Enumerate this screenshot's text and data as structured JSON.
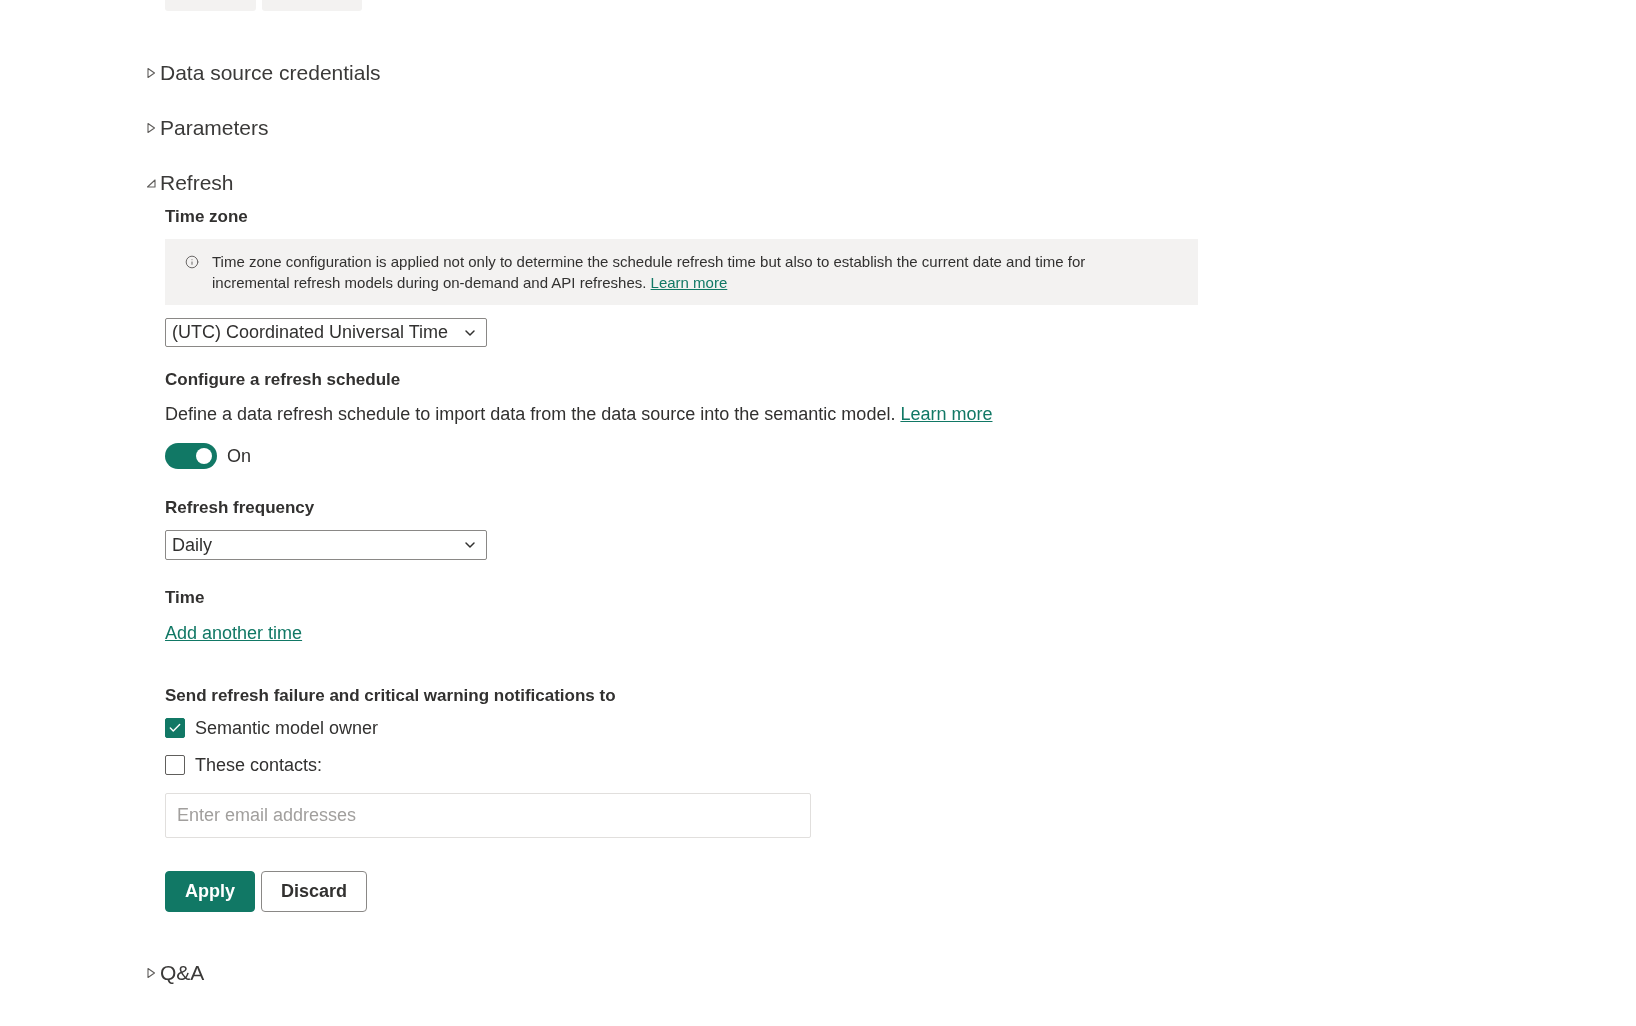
{
  "previous_section_buttons": [
    {
      "disabled": true
    },
    {
      "disabled": true
    }
  ],
  "sections": [
    {
      "title": "Data source credentials",
      "expanded": false
    },
    {
      "title": "Parameters",
      "expanded": false
    },
    {
      "title": "Refresh",
      "expanded": true,
      "content": {
        "time_zone": {
          "label": "Time zone",
          "info": "Time zone configuration is applied not only to determine the schedule refresh time but also to establish the current date and time for incremental refresh models during on-demand and API refreshes.",
          "info_link": "Learn more",
          "value": "(UTC) Coordinated Universal Time"
        },
        "schedule": {
          "label": "Configure a refresh schedule",
          "description": "Define a data refresh schedule to import data from the data source into the semantic model.",
          "link": "Learn more",
          "toggle": {
            "on": true,
            "label": "On"
          }
        },
        "frequency": {
          "label": "Refresh frequency",
          "value": "Daily"
        },
        "time": {
          "label": "Time",
          "link": "Add another time"
        },
        "notifications": {
          "label": "Send refresh failure and critical warning notifications to",
          "options": [
            {
              "label": "Semantic model owner",
              "checked": true
            },
            {
              "label": "These contacts:",
              "checked": false
            }
          ],
          "email": {
            "placeholder": "Enter email addresses"
          }
        },
        "buttons": [
          {
            "label": "Apply",
            "kind": "primary"
          },
          {
            "label": "Discard",
            "kind": "secondary"
          }
        ]
      }
    },
    {
      "title": "Q&A",
      "expanded": false
    }
  ]
}
